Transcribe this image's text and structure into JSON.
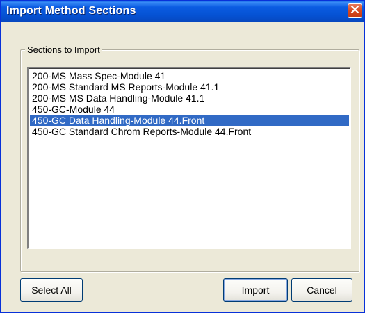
{
  "window": {
    "title": "Import Method Sections"
  },
  "group": {
    "legend": "Sections to Import"
  },
  "list": {
    "items": [
      "200-MS Mass Spec-Module 41",
      "200-MS Standard MS Reports-Module 41.1",
      "200-MS MS Data Handling-Module 41.1",
      "450-GC-Module 44",
      "450-GC Data Handling-Module 44.Front",
      "450-GC Standard Chrom Reports-Module 44.Front"
    ],
    "selected_index": 4
  },
  "buttons": {
    "select_all": "Select All",
    "import": "Import",
    "cancel": "Cancel"
  },
  "icons": {
    "close": "close-icon"
  },
  "colors": {
    "titlebar": "#0552d3",
    "selection": "#316ac5",
    "dialog_bg": "#ece9d8"
  }
}
